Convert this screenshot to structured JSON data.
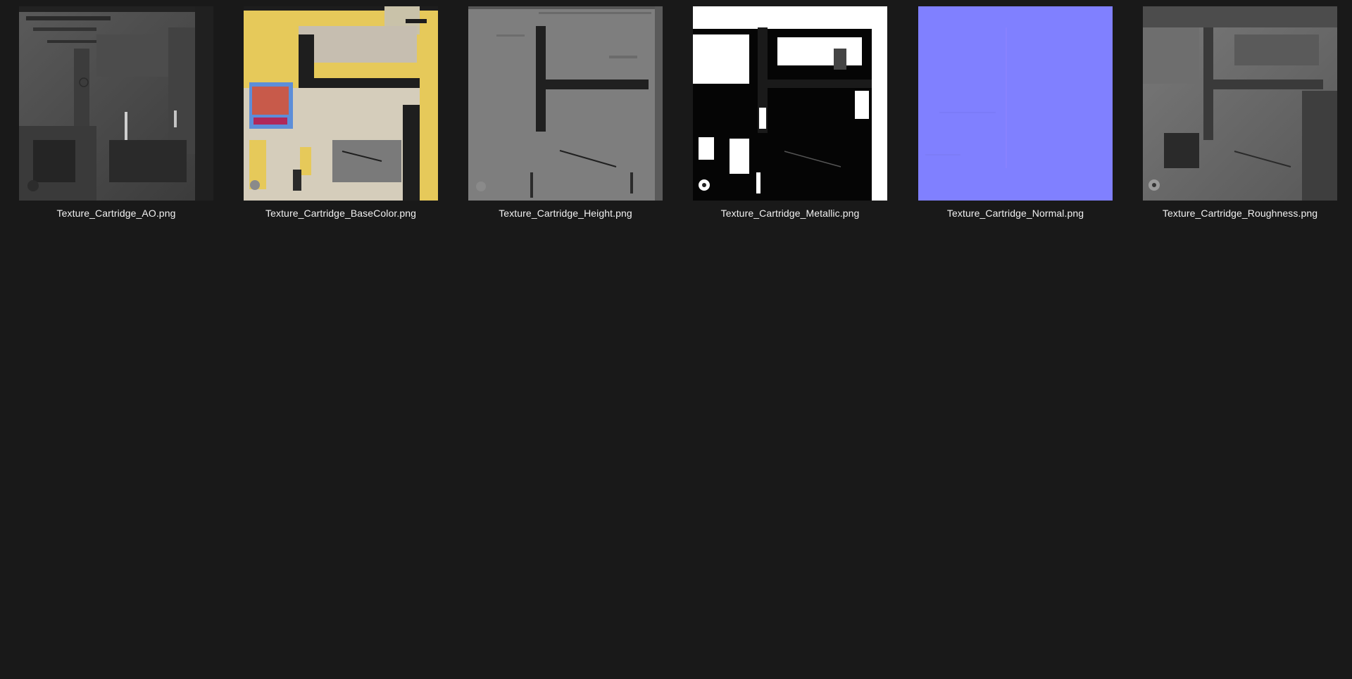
{
  "files": [
    {
      "name": "Texture_Cartridge_AO.png",
      "icon": "ao-texture-thumbnail"
    },
    {
      "name": "Texture_Cartridge_BaseColor.png",
      "icon": "basecolor-texture-thumbnail",
      "accent": "#e8cc5c"
    },
    {
      "name": "Texture_Cartridge_Height.png",
      "icon": "height-texture-thumbnail"
    },
    {
      "name": "Texture_Cartridge_Metallic.png",
      "icon": "metallic-texture-thumbnail"
    },
    {
      "name": "Texture_Cartridge_Normal.png",
      "icon": "normal-texture-thumbnail",
      "accent": "#8080ff"
    },
    {
      "name": "Texture_Cartridge_Roughness.png",
      "icon": "roughness-texture-thumbnail"
    }
  ],
  "theme": {
    "background": "#191919",
    "text": "#f2f2f2"
  }
}
